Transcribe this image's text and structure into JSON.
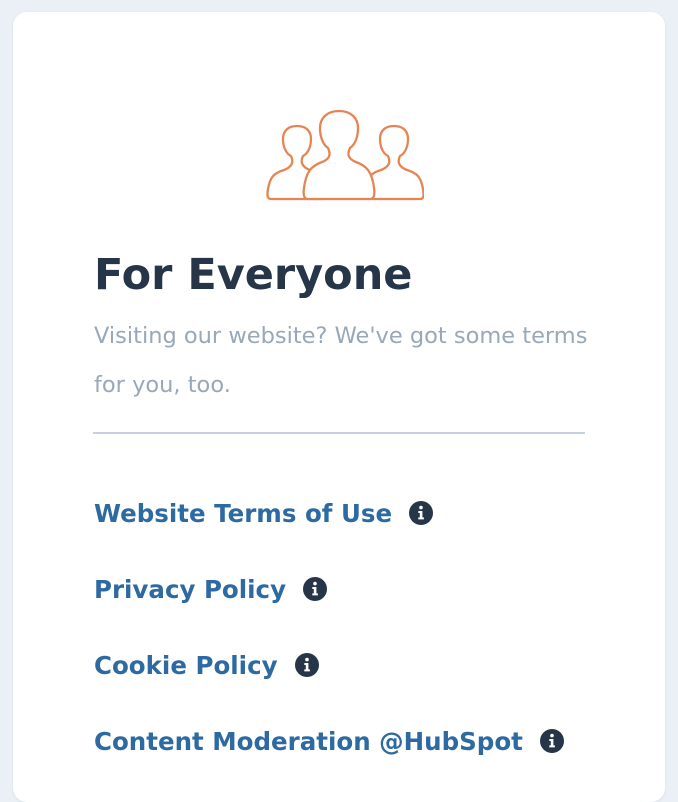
{
  "colors": {
    "background": "#eaf0f6",
    "card": "#ffffff",
    "accent_orange": "#e68453",
    "title": "#273548",
    "subtitle": "#99a8b9",
    "link": "#2e6aa2",
    "info_icon": "#273548"
  },
  "section": {
    "icon": "people-group-icon",
    "title": "For Everyone",
    "subtitle": "Visiting our website? We've got some terms for you, too."
  },
  "links": [
    {
      "label": "Website Terms of Use",
      "icon": "info-icon"
    },
    {
      "label": "Privacy Policy",
      "icon": "info-icon"
    },
    {
      "label": "Cookie Policy",
      "icon": "info-icon"
    },
    {
      "label": "Content Moderation @HubSpot",
      "icon": "info-icon"
    }
  ]
}
